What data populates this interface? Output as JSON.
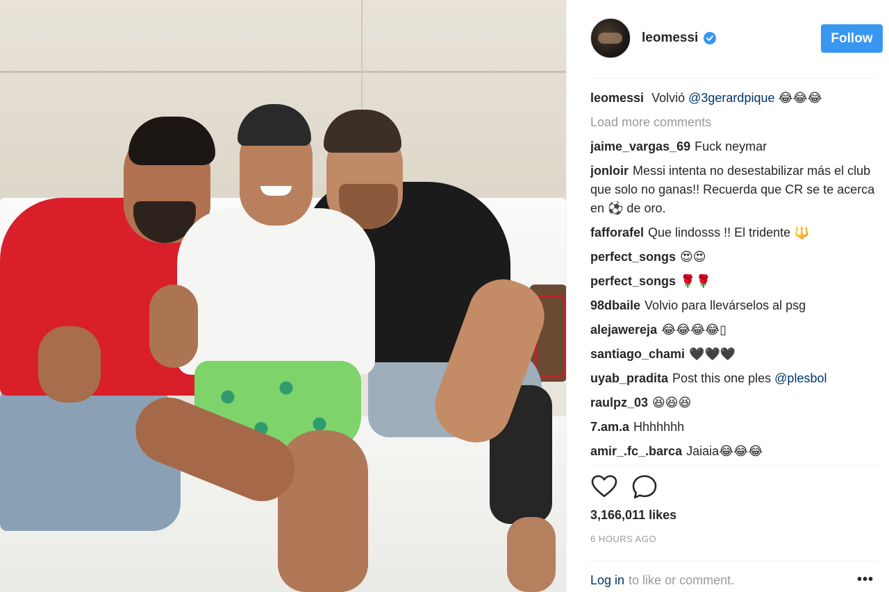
{
  "post": {
    "username": "leomessi",
    "follow_label": "Follow",
    "caption": {
      "user": "leomessi",
      "text": "Volvió",
      "mention": "@3gerardpique",
      "emoji": "😂😂😂"
    },
    "load_more": "Load more comments",
    "comments": [
      {
        "user": "jaime_vargas_69",
        "text": "Fuck neymar"
      },
      {
        "user": "jonloir",
        "text": "Messi intenta no desestabilizar más el club que solo no ganas!! Recuerda que CR se te acerca en ⚽ de oro."
      },
      {
        "user": "fafforafel",
        "text": "Que lindosss !! El tridente 🔱"
      },
      {
        "user": "perfect_songs",
        "text": "😍😍"
      },
      {
        "user": "perfect_songs",
        "text": "🌹🌹"
      },
      {
        "user": "98dbaile",
        "text": "Volvio para llevárselos al psg"
      },
      {
        "user": "alejawereja",
        "text": "😂😂😂😂▯"
      },
      {
        "user": "santiago_chami",
        "text": "🖤🖤🖤"
      },
      {
        "user": "uyab_pradita",
        "text": "Post this one ples",
        "mention": "@plesbol"
      },
      {
        "user": "raulpz_03",
        "text": "😆😆😆"
      },
      {
        "user": "7.am.a",
        "text": "Hhhhhhh"
      },
      {
        "user": "amir_.fc_.barca",
        "text": "Jaiaia😂😂😂"
      }
    ],
    "likes": "3,166,011 likes",
    "time_ago": "6 HOURS AGO",
    "footer": {
      "login_label": "Log in",
      "rest": "to like or comment."
    },
    "more_label": "•••",
    "colors": {
      "accent": "#3897f0",
      "link": "#003569",
      "muted": "#999999"
    },
    "icons": [
      "verified-badge-icon",
      "heart-icon",
      "comment-bubble-icon",
      "more-options-icon"
    ]
  }
}
